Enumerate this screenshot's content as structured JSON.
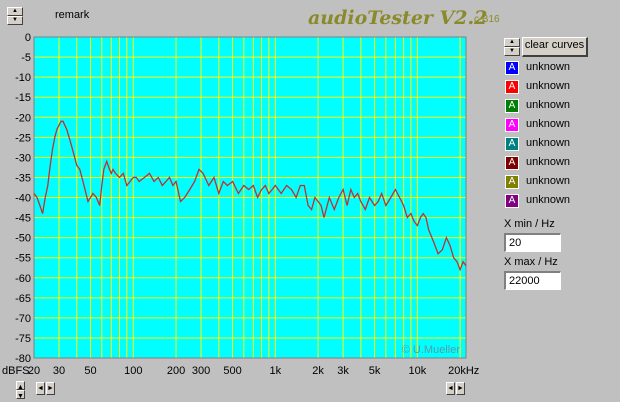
{
  "header": {
    "remark_label": "remark",
    "app_title": "audioTester V2.2",
    "version_suffix": "c B16"
  },
  "right_panel": {
    "clear_button": "clear curves",
    "legend": [
      {
        "letter": "A",
        "label": "unknown",
        "color": "#0000ff"
      },
      {
        "letter": "A",
        "label": "unknown",
        "color": "#ff0000"
      },
      {
        "letter": "A",
        "label": "unknown",
        "color": "#008000"
      },
      {
        "letter": "A",
        "label": "unknown",
        "color": "#ff00ff"
      },
      {
        "letter": "A",
        "label": "unknown",
        "color": "#008080"
      },
      {
        "letter": "A",
        "label": "unknown",
        "color": "#800000"
      },
      {
        "letter": "A",
        "label": "unknown",
        "color": "#808000"
      },
      {
        "letter": "A",
        "label": "unknown",
        "color": "#800080"
      }
    ],
    "xmin_label": "X min / Hz",
    "xmin_value": "20",
    "xmax_label": "X max / Hz",
    "xmax_value": "22000"
  },
  "chart_data": {
    "type": "line",
    "xscale": "log",
    "xlim": [
      20,
      22000
    ],
    "ylim": [
      -80,
      0
    ],
    "grid": true,
    "background": "#00ffff",
    "grid_color": "#ffff00",
    "line_color": "#c03030",
    "ylabel": "dBFS",
    "xunit": "Hz",
    "copyright": "© U.Mueller",
    "yticks": [
      "0",
      "-5",
      "-10",
      "-15",
      "-20",
      "-25",
      "-30",
      "-35",
      "-40",
      "-45",
      "-50",
      "-55",
      "-60",
      "-65",
      "-70",
      "-75",
      "-80"
    ],
    "xticks": [
      {
        "value": 20,
        "label": "20"
      },
      {
        "value": 30,
        "label": "30"
      },
      {
        "value": 50,
        "label": "50"
      },
      {
        "value": 100,
        "label": "100"
      },
      {
        "value": 200,
        "label": "200"
      },
      {
        "value": 300,
        "label": "300"
      },
      {
        "value": 500,
        "label": "500"
      },
      {
        "value": 1000,
        "label": "1k"
      },
      {
        "value": 2000,
        "label": "2k"
      },
      {
        "value": 3000,
        "label": "3k"
      },
      {
        "value": 5000,
        "label": "5k"
      },
      {
        "value": 10000,
        "label": "10k"
      },
      {
        "value": 20000,
        "label": "20kHz"
      }
    ],
    "series": [
      {
        "x": [
          20,
          21,
          22,
          23,
          24,
          25,
          26,
          27,
          28,
          29,
          30,
          31,
          32,
          34,
          36,
          38,
          40,
          42,
          45,
          48,
          50,
          52,
          55,
          58,
          60,
          62,
          65,
          68,
          70,
          72,
          75,
          80,
          85,
          90,
          95,
          100,
          105,
          110,
          120,
          130,
          140,
          150,
          160,
          170,
          180,
          190,
          200,
          215,
          230,
          250,
          270,
          290,
          310,
          340,
          370,
          400,
          430,
          460,
          500,
          550,
          600,
          650,
          700,
          750,
          800,
          850,
          900,
          950,
          1000,
          1100,
          1200,
          1300,
          1400,
          1500,
          1600,
          1700,
          1800,
          1900,
          2000,
          2100,
          2200,
          2400,
          2600,
          2800,
          3000,
          3200,
          3400,
          3600,
          3800,
          4000,
          4300,
          4600,
          5000,
          5300,
          5600,
          6000,
          6500,
          7000,
          7500,
          8000,
          8500,
          9000,
          9500,
          10000,
          10500,
          11000,
          11500,
          12000,
          13000,
          14000,
          15000,
          16000,
          17000,
          18000,
          19000,
          20000,
          21000,
          22000
        ],
        "y": [
          -39,
          -40,
          -42,
          -44,
          -40,
          -37,
          -32,
          -28,
          -25,
          -23,
          -22,
          -21,
          -21,
          -23,
          -26,
          -29,
          -32,
          -33,
          -37,
          -41,
          -40,
          -39,
          -40,
          -42,
          -37,
          -33,
          -31,
          -33,
          -34,
          -33,
          -34,
          -35,
          -34,
          -37,
          -36,
          -35,
          -35,
          -36,
          -35,
          -34,
          -36,
          -35,
          -37,
          -36,
          -35,
          -37,
          -36,
          -41,
          -40,
          -38,
          -36,
          -33,
          -34,
          -37,
          -35,
          -39,
          -36,
          -37,
          -36,
          -39,
          -37,
          -38,
          -37,
          -40,
          -38,
          -37,
          -39,
          -38,
          -37,
          -39,
          -37,
          -38,
          -40,
          -37,
          -37,
          -42,
          -43,
          -40,
          -41,
          -42,
          -45,
          -40,
          -43,
          -40,
          -38,
          -42,
          -38,
          -40,
          -39,
          -41,
          -43,
          -40,
          -42,
          -41,
          -39,
          -42,
          -40,
          -38,
          -40,
          -42,
          -45,
          -44,
          -46,
          -47,
          -45,
          -44,
          -45,
          -48,
          -51,
          -54,
          -53,
          -50,
          -52,
          -55,
          -56,
          -58,
          -56,
          -57
        ]
      }
    ]
  }
}
